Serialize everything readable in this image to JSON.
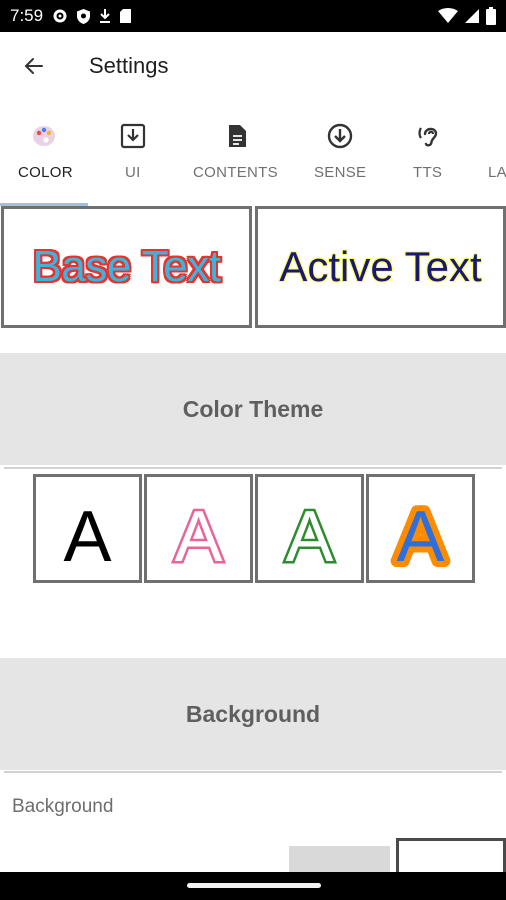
{
  "status_bar": {
    "time": "7:59",
    "left_icons": [
      "gear-icon",
      "shield-icon",
      "download-icon",
      "sd-card-icon"
    ],
    "right_icons": [
      "wifi-icon",
      "cell-signal-icon",
      "battery-icon"
    ]
  },
  "app_bar": {
    "back_icon": "arrow-back-icon",
    "title": "Settings"
  },
  "tabs": [
    {
      "label": "COLOR",
      "icon": "palette-icon",
      "active": true
    },
    {
      "label": "UI",
      "icon": "download-box-icon",
      "active": false
    },
    {
      "label": "CONTENTS",
      "icon": "document-icon",
      "active": false
    },
    {
      "label": "SENSE",
      "icon": "arrow-circle-down-icon",
      "active": false
    },
    {
      "label": "TTS",
      "icon": "hearing-icon",
      "active": false
    },
    {
      "label": "LA",
      "icon": "",
      "active": false
    }
  ],
  "preview": {
    "base_text": "Base Text",
    "active_text": "Active Text"
  },
  "sections": {
    "color_theme": "Color Theme",
    "background": "Background"
  },
  "theme_options": [
    {
      "letter": "A",
      "fill": "#000000",
      "stroke": "#000000"
    },
    {
      "letter": "A",
      "fill": "#ffffff",
      "stroke": "#e8649a"
    },
    {
      "letter": "A",
      "fill": "#ffffff",
      "stroke": "#2e8b2e"
    },
    {
      "letter": "A",
      "fill": "#2f6fdc",
      "stroke": "#ff8c00"
    }
  ],
  "background_label": "Background",
  "colors": {
    "tab_indicator": "#9ac2e6",
    "section_bg": "#e5e5e5",
    "base_text_fill": "#3fb3df",
    "base_text_outline": "#e3342f",
    "active_text_fill": "#191970",
    "active_text_outline": "#ffff66"
  }
}
